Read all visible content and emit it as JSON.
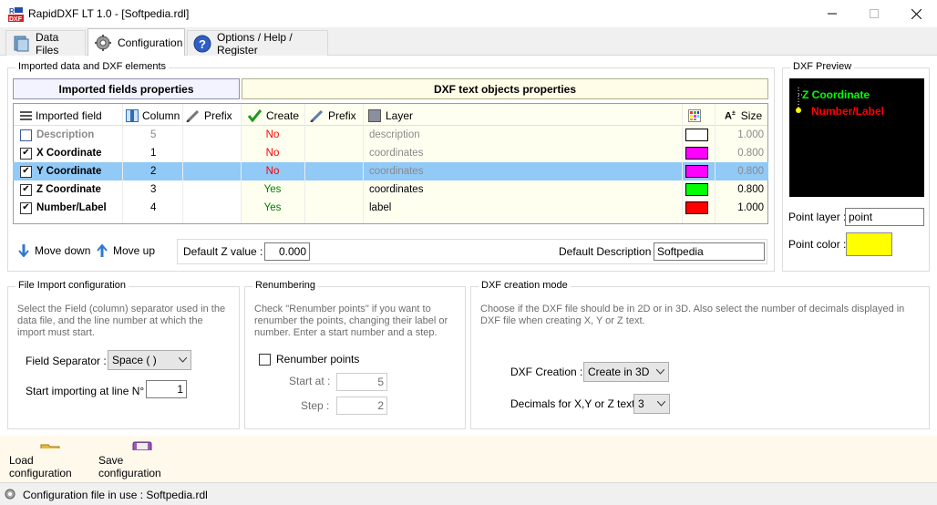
{
  "window": {
    "title": "RapidDXF LT 1.0 - [Softpedia.rdl]"
  },
  "tabs": [
    {
      "label": "Data Files"
    },
    {
      "label": "Configuration"
    },
    {
      "label": "Options / Help / Register"
    }
  ],
  "imported_group": {
    "title": "Imported data and DXF elements",
    "band_left": "Imported fields properties",
    "band_right": "DXF text objects properties",
    "columns": {
      "imported_field": "Imported field",
      "column": "Column",
      "prefix": "Prefix",
      "create": "Create",
      "prefix2": "Prefix",
      "layer": "Layer",
      "size": "Size"
    },
    "rows": [
      {
        "field": "Description",
        "column": "5",
        "create": "No",
        "layer": "description",
        "color": "#ffffff",
        "size": "1.000"
      },
      {
        "field": "X Coordinate",
        "column": "1",
        "create": "No",
        "layer": "coordinates",
        "color": "#ff00ff",
        "size": "0.800"
      },
      {
        "field": "Y Coordinate",
        "column": "2",
        "create": "No",
        "layer": "coordinates",
        "color": "#ff00ff",
        "size": "0.800"
      },
      {
        "field": "Z Coordinate",
        "column": "3",
        "create": "Yes",
        "layer": "coordinates",
        "color": "#00ff00",
        "size": "0.800"
      },
      {
        "field": "Number/Label",
        "column": "4",
        "create": "Yes",
        "layer": "label",
        "color": "#ff0000",
        "size": "1.000"
      }
    ],
    "move_down": "Move down",
    "move_up": "Move up",
    "default_z_label": "Default Z value :",
    "default_z_value": "0.000",
    "default_desc_label": "Default Description :",
    "default_desc_value": "Softpedia"
  },
  "preview": {
    "title": "DXF Preview",
    "z_label": "Z Coordinate",
    "num_label": "Number/Label",
    "point_layer_label": "Point layer :",
    "point_layer_value": "point",
    "point_color_label": "Point color :",
    "point_color": "#ffff00"
  },
  "file_import": {
    "title": "File Import configuration",
    "description": "Select the Field (column) separator used in the data file, and the line number at which the import must start.",
    "separator_label": "Field Separator :",
    "separator_value": "Space ( )",
    "start_label": "Start importing at line N° :",
    "start_value": "1"
  },
  "renumbering": {
    "title": "Renumbering",
    "description": "Check \"Renumber points\" if you want to renumber the  points, changing their  label or number. Enter a start number and a step.",
    "checkbox_label": "Renumber points",
    "start_label": "Start at :",
    "start_value": "5",
    "step_label": "Step :",
    "step_value": "2"
  },
  "dxf_mode": {
    "title": "DXF creation mode",
    "description": "Choose if the DXF file should be in 2D or in 3D.  Also select the number of decimals displayed in DXF file when creating X, Y or Z text.",
    "creation_label": "DXF Creation :",
    "creation_value": "Create in 3D",
    "decimals_label": "Decimals for X,Y or Z text :",
    "decimals_value": "3"
  },
  "bottom": {
    "load_label": "Load configuration",
    "save_label": "Save configuration"
  },
  "status": {
    "text": "Configuration file in use : Softpedia.rdl"
  },
  "colors": {
    "selection": "#91c9f7",
    "accent": "#0078d7",
    "yes": "#008000",
    "no": "#ff0000"
  }
}
